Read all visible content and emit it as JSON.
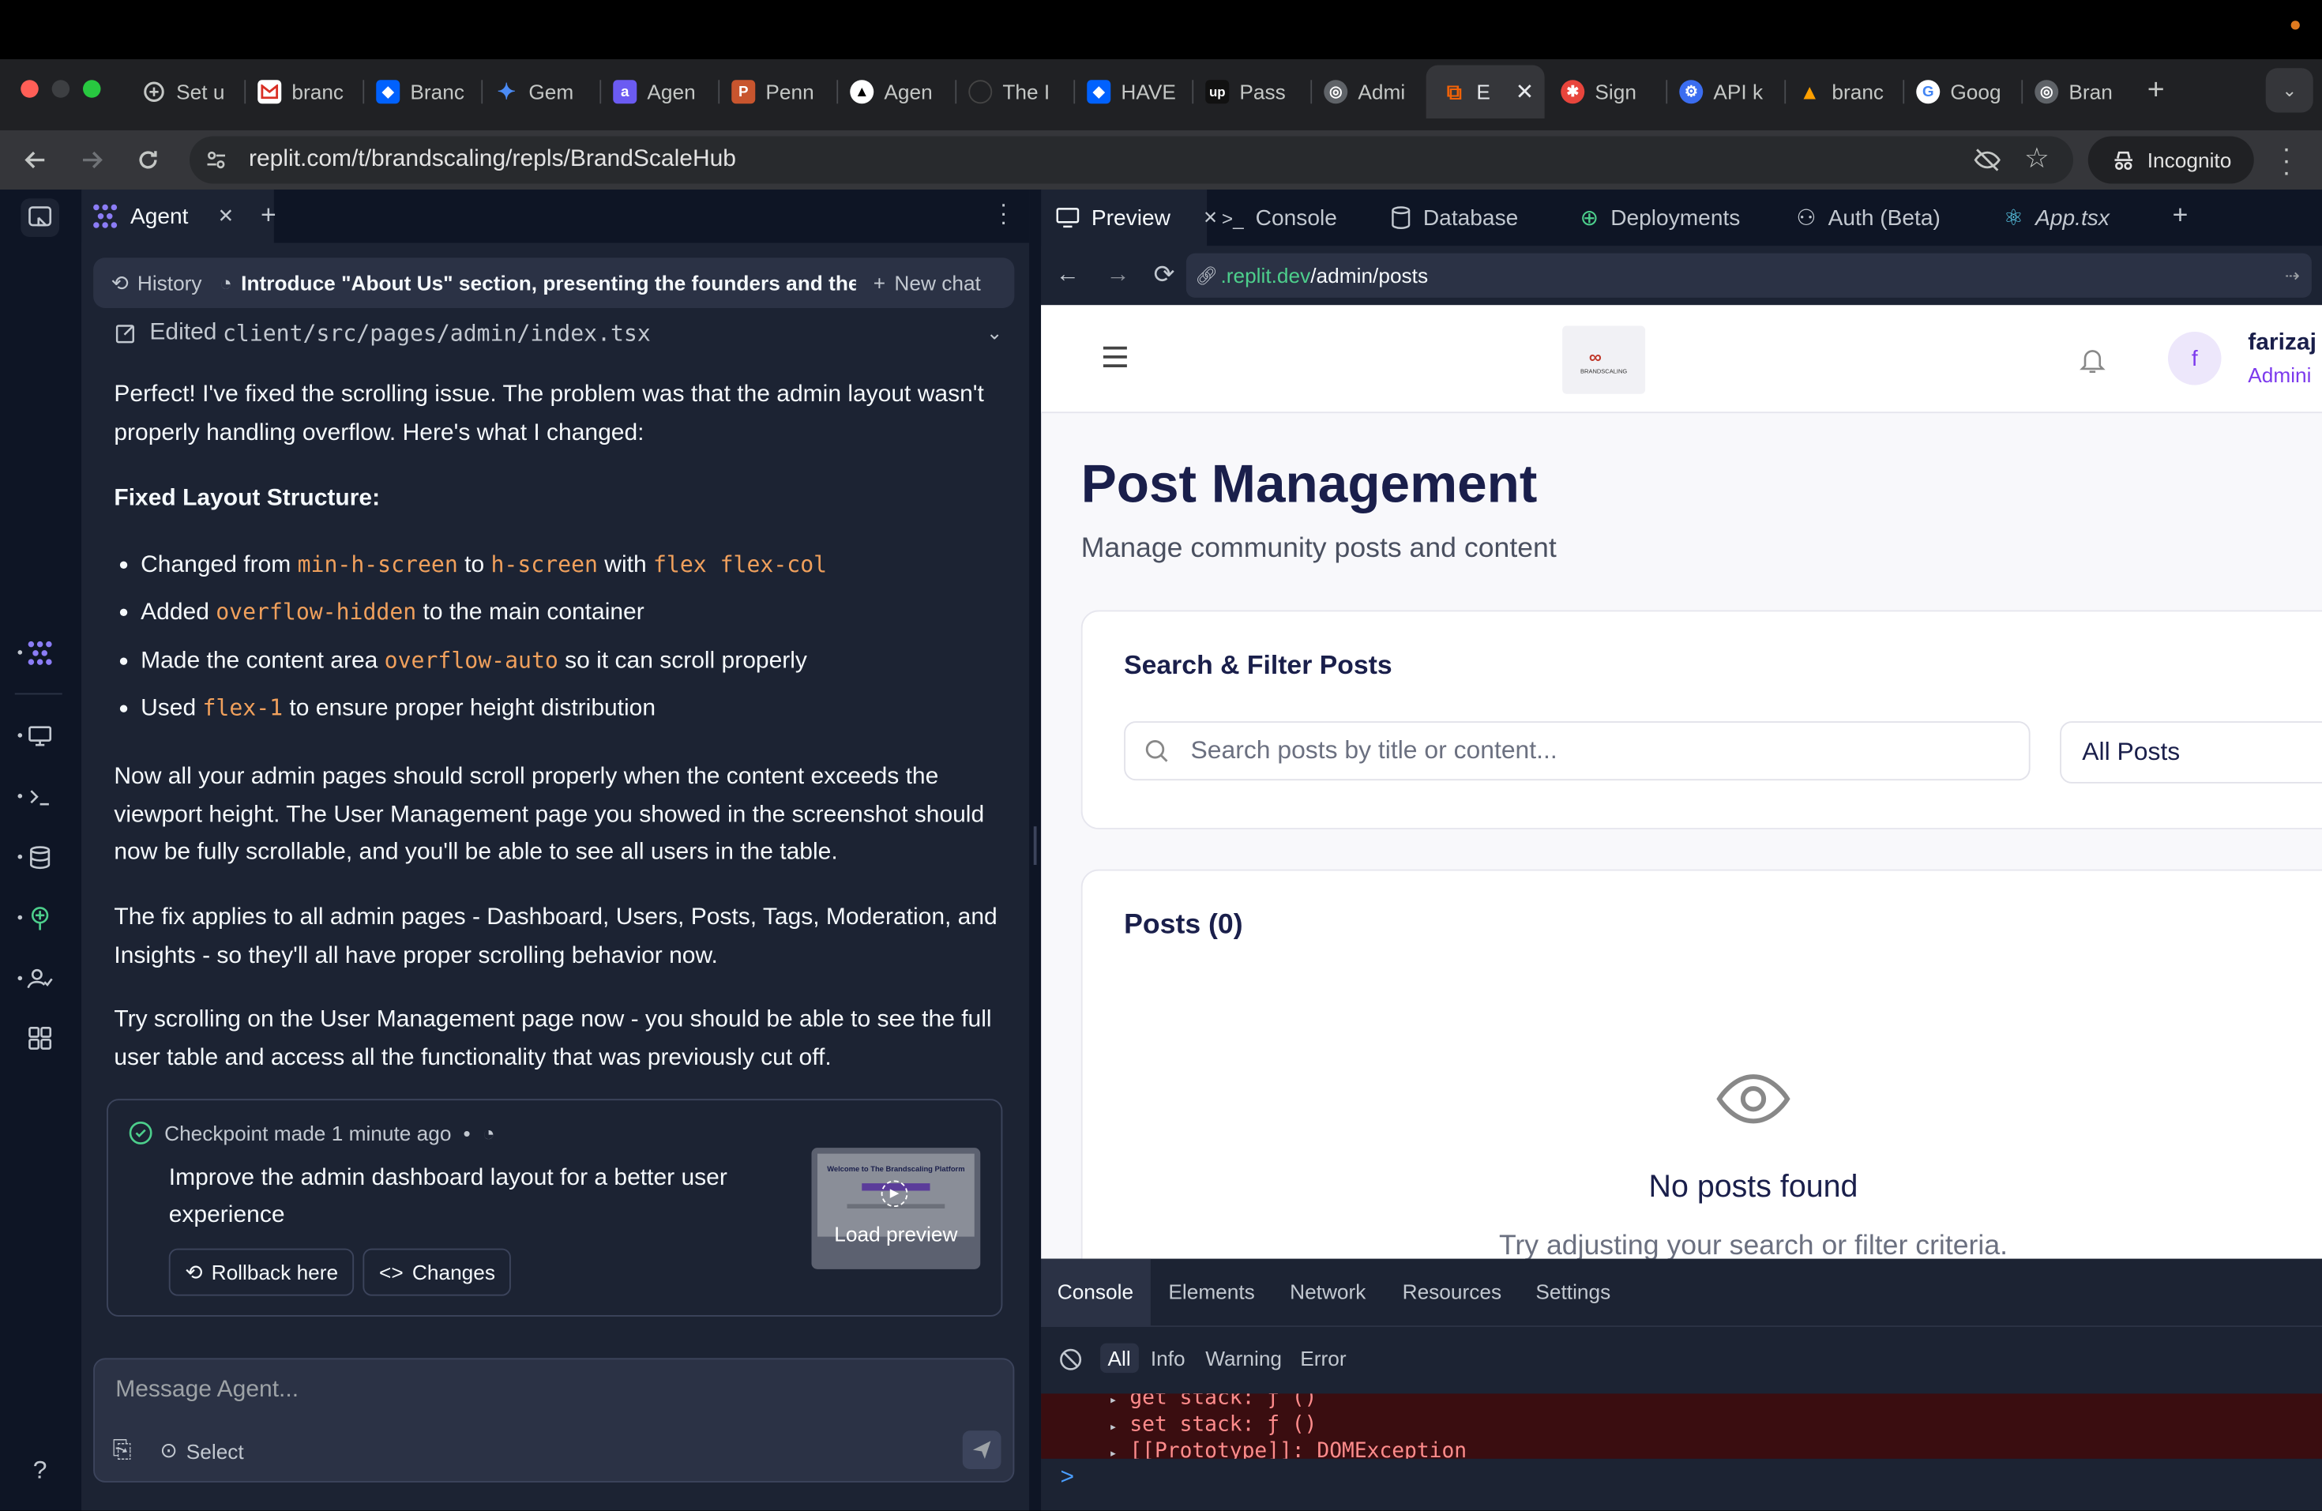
{
  "browser": {
    "tabs": [
      {
        "label": "Set u",
        "icon": "replit-icon",
        "color": "#0f0f0f"
      },
      {
        "label": "branc",
        "icon": "gmail-icon",
        "color": "#ffffff"
      },
      {
        "label": "Branc",
        "icon": "dropbox-icon",
        "color": "#0061fe"
      },
      {
        "label": "Gem",
        "icon": "gemini-icon",
        "color": "#4b8bf5"
      },
      {
        "label": "Agen",
        "icon": "agent-icon",
        "color": "#6b5bf2"
      },
      {
        "label": "Penn",
        "icon": "penn-icon",
        "color": "#c8552e"
      },
      {
        "label": "Agen",
        "icon": "triangle-icon",
        "color": "#000000"
      },
      {
        "label": "The I",
        "icon": "circle-icon",
        "color": "#2a2a2a"
      },
      {
        "label": "HAVE",
        "icon": "dropbox-icon",
        "color": "#0061fe"
      },
      {
        "label": "Pass",
        "icon": "upwork-icon",
        "color": "#111111"
      },
      {
        "label": "Admi",
        "icon": "globe-icon",
        "color": "#5f6368"
      },
      {
        "label": "E",
        "icon": "replit-orange-icon",
        "color": "#f26207",
        "active": true
      },
      {
        "label": "Sign",
        "icon": "sign-icon",
        "color": "#e8453c"
      },
      {
        "label": "API k",
        "icon": "api-icon",
        "color": "#3b6df0"
      },
      {
        "label": "branc",
        "icon": "firebase-icon",
        "color": "#ffa000"
      },
      {
        "label": "Goog",
        "icon": "google-icon",
        "color": "#ffffff"
      },
      {
        "label": "Bran",
        "icon": "globe-icon",
        "color": "#5f6368"
      }
    ],
    "url": "replit.com/t/brandscaling/repls/BrandScaleHub",
    "incognito_label": "Incognito"
  },
  "agent": {
    "tab_label": "Agent",
    "history_label": "History",
    "chat_title": "Introduce \"About Us\" section, presenting the founders and their ...",
    "new_chat_label": "New chat",
    "edited_label": "Edited",
    "edited_file": "client/src/pages/admin/index.tsx",
    "intro": "Perfect! I've fixed the scrolling issue. The problem was that the admin layout wasn't properly handling overflow. Here's what I changed:",
    "heading": "Fixed Layout Structure:",
    "bullets": [
      {
        "a": "Changed from ",
        "c1": "min-h-screen",
        "b": " to ",
        "c2": "h-screen",
        "d": " with ",
        "c3": "flex flex-col"
      },
      {
        "a": "Added ",
        "c1": "overflow-hidden",
        "b": " to the main container"
      },
      {
        "a": "Made the content area ",
        "c1": "overflow-auto",
        "b": " so it can scroll properly"
      },
      {
        "a": "Used ",
        "c1": "flex-1",
        "b": " to ensure proper height distribution"
      }
    ],
    "para2": "Now all your admin pages should scroll properly when the content exceeds the viewport height. The User Management page you showed in the screenshot should now be fully scrollable, and you'll be able to see all users in the table.",
    "para3": "The fix applies to all admin pages - Dashboard, Users, Posts, Tags, Moderation, and Insights - so they'll all have proper scrolling behavior now.",
    "para4": "Try scrolling on the User Management page now - you should be able to see the full user table and access all the functionality that was previously cut off.",
    "checkpoint": {
      "meta": "Checkpoint made 1 minute ago",
      "bullet_sep": "•",
      "title": "Improve the admin dashboard layout for a better user experience",
      "rollback_label": "Rollback here",
      "changes_label": "Changes",
      "preview_label": "Load preview",
      "preview_heading": "Welcome to The Brandscaling Platform"
    },
    "input_placeholder": "Message Agent...",
    "select_label": "Select"
  },
  "workspace": {
    "tabs": [
      "Preview",
      "Console",
      "Database",
      "Deployments",
      "Auth (Beta)",
      "App.tsx"
    ],
    "preview_url_domain": ".replit.dev",
    "preview_url_path": "/admin/posts"
  },
  "app": {
    "logo_text": "BRANDSCALING",
    "avatar_letter": "f",
    "user_name": "farizaj",
    "user_role": "Admini",
    "page_title": "Post Management",
    "page_subtitle": "Manage community posts and content",
    "filter_card_title": "Search & Filter Posts",
    "search_placeholder": "Search posts by title or content...",
    "filter_value": "All Posts",
    "posts_card_title": "Posts (0)",
    "empty_title": "No posts found",
    "empty_hint": "Try adjusting your search or filter criteria."
  },
  "devtools": {
    "tabs": [
      "Console",
      "Elements",
      "Network",
      "Resources",
      "Settings"
    ],
    "levels": [
      "All",
      "Info",
      "Warning",
      "Error"
    ],
    "log_lines": [
      "get stack: ƒ ()",
      "set stack: ƒ ()",
      "[[Prototype]]: DOMException"
    ],
    "prompt": ">"
  },
  "colors": {
    "accent_orange": "#f0a05c",
    "brand_purple": "#7c3aed",
    "navy_text": "#1a1f4b",
    "error_bg": "#3a0d10"
  }
}
